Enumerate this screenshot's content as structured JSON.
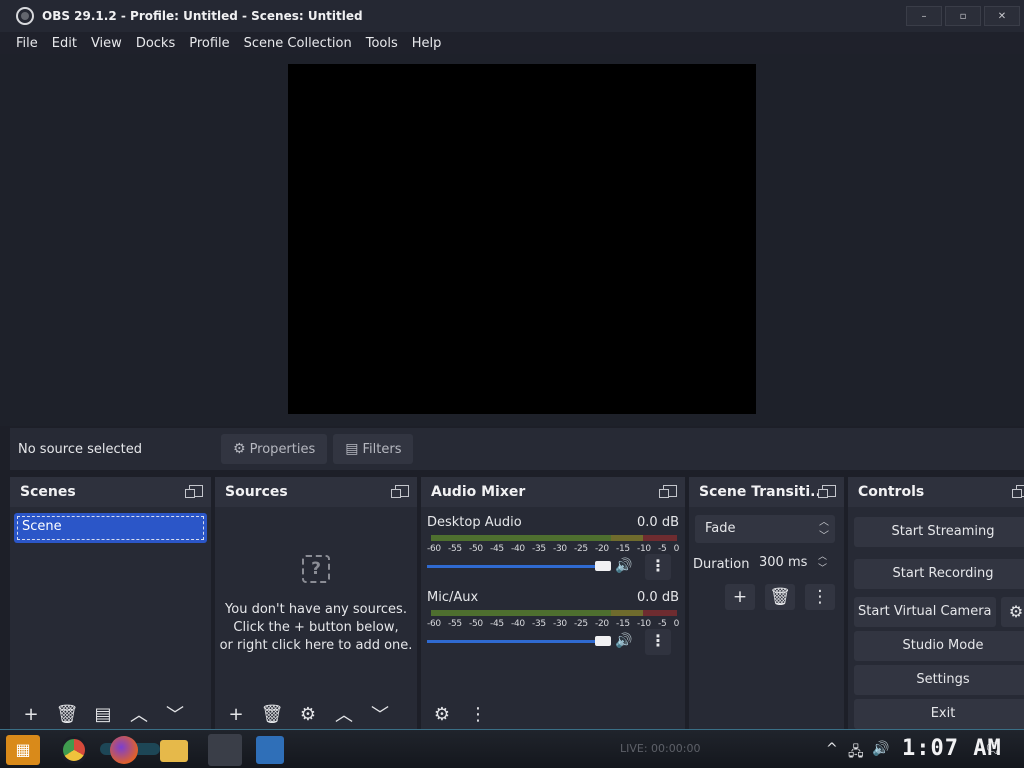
{
  "window": {
    "title": "OBS 29.1.2 - Profile: Untitled - Scenes: Untitled",
    "min": "–",
    "max": "▫",
    "close": "✕"
  },
  "menu": [
    "File",
    "Edit",
    "View",
    "Docks",
    "Profile",
    "Scene Collection",
    "Tools",
    "Help"
  ],
  "context": {
    "no_source": "No source selected",
    "properties": "Properties",
    "filters": "Filters"
  },
  "scenes": {
    "title": "Scenes",
    "items": [
      "Scene"
    ]
  },
  "sources": {
    "title": "Sources",
    "empty_icon": "?",
    "empty_lines": [
      "You don't have any sources.",
      "Click the + button below,",
      "or right click here to add one."
    ]
  },
  "mixer": {
    "title": "Audio Mixer",
    "ticks": [
      "-60",
      "-55",
      "-50",
      "-45",
      "-40",
      "-35",
      "-30",
      "-25",
      "-20",
      "-15",
      "-10",
      "-5",
      "0"
    ],
    "channels": [
      {
        "name": "Desktop Audio",
        "db": "0.0 dB",
        "volume": 1.0
      },
      {
        "name": "Mic/Aux",
        "db": "0.0 dB",
        "volume": 1.0
      }
    ]
  },
  "transitions": {
    "title": "Scene Transiti...",
    "selected": "Fade",
    "duration_label": "Duration",
    "duration_value": "300 ms"
  },
  "controls": {
    "title": "Controls",
    "start_streaming": "Start Streaming",
    "start_recording": "Start Recording",
    "start_virtual_camera": "Start Virtual Camera",
    "studio_mode": "Studio Mode",
    "settings": "Settings",
    "exit": "Exit"
  },
  "taskbar": {
    "live": "LIVE: 00:00:00",
    "clock": "1:07 AM"
  },
  "colors": {
    "accent": "#2b56c8",
    "panel": "#272a35",
    "slider": "#2f6ad1"
  }
}
